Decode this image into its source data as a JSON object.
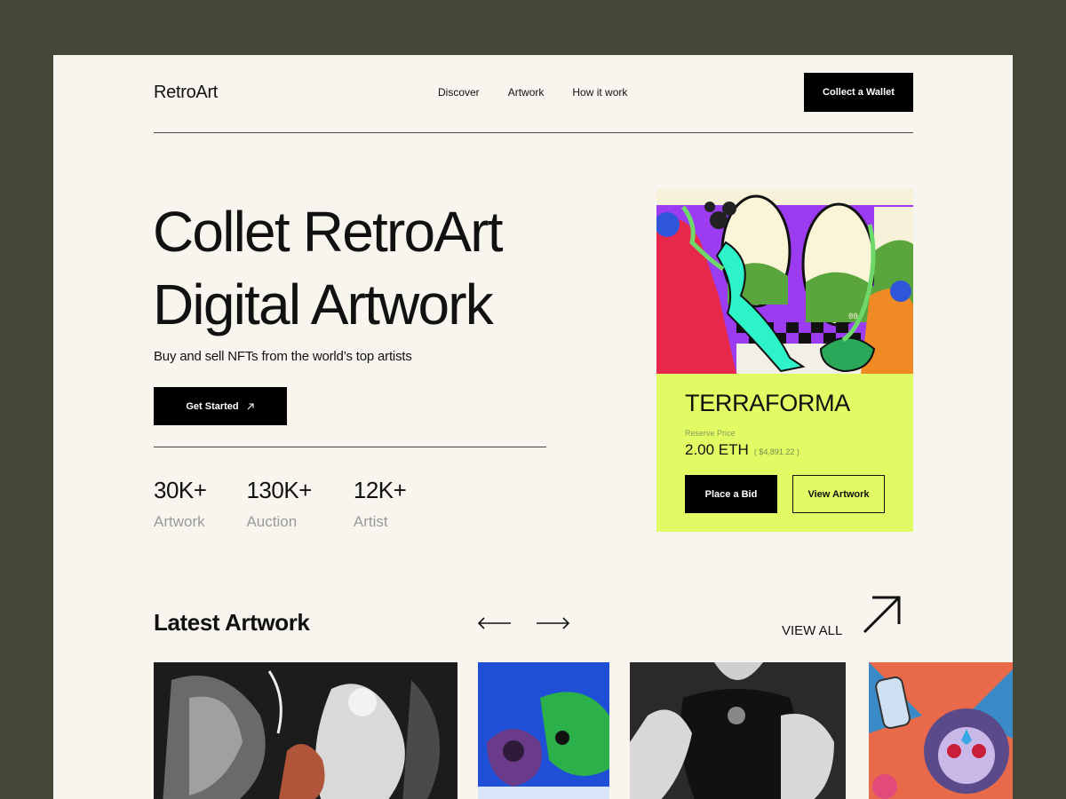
{
  "header": {
    "logo": "RetroArt",
    "nav": [
      "Discover",
      "Artwork",
      "How it work"
    ],
    "wallet_button": "Collect a Wallet"
  },
  "hero": {
    "title_line1": "Collet RetroArt",
    "title_line2": "Digital Artwork",
    "subtitle": "Buy and sell NFTs from the world’s top artists",
    "cta": "Get Started",
    "stats": [
      {
        "value": "30K+",
        "label": "Artwork"
      },
      {
        "value": "130K+",
        "label": "Auction"
      },
      {
        "value": "12K+",
        "label": "Artist"
      }
    ]
  },
  "featured": {
    "title": "TERRAFORMA",
    "reserve_label": "Reserve Price",
    "price": "2.00 ETH",
    "usd": "( $4,891.22 )",
    "art_tag": "00",
    "bid_button": "Place a Bid",
    "view_button": "View Artwork"
  },
  "latest": {
    "title": "Latest Artwork",
    "view_all": "VIEW ALL"
  },
  "colors": {
    "page_bg": "#454837",
    "canvas": "#f8f5ef",
    "card_accent": "#e0fb63",
    "button": "#000000"
  },
  "icons": [
    "arrow-up-right-icon",
    "arrow-left-icon",
    "arrow-right-icon"
  ]
}
